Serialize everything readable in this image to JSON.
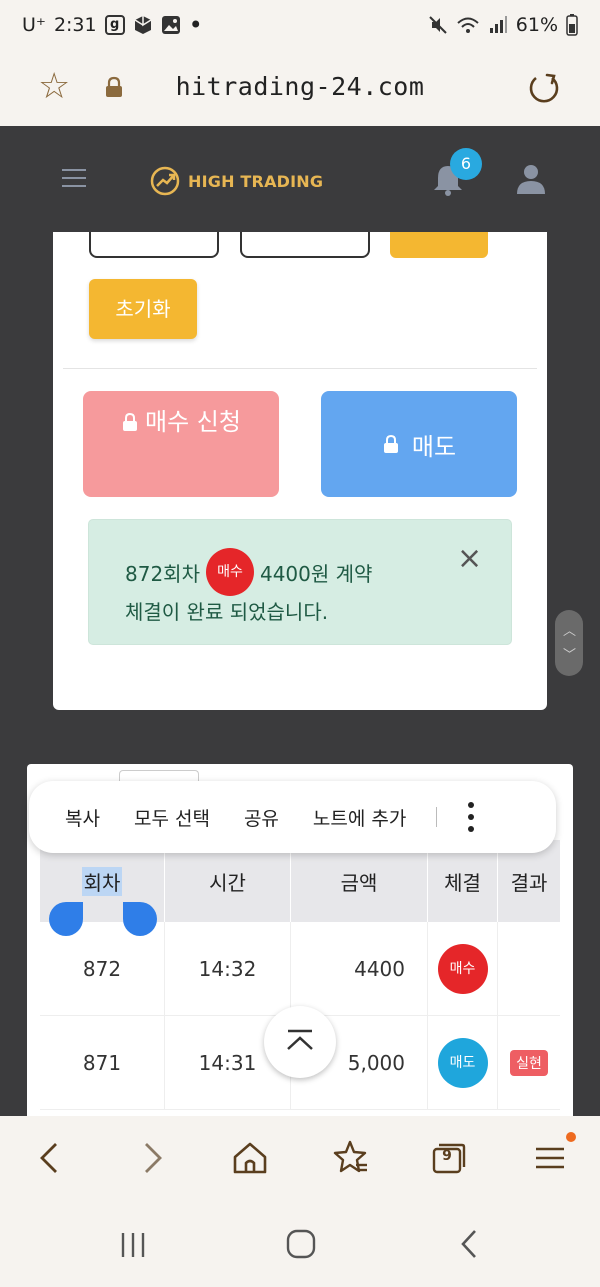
{
  "status_bar": {
    "carrier": "U⁺",
    "time": "2:31",
    "app_icon_g": "g",
    "battery": "61%",
    "icons": [
      "box-icon",
      "image-icon",
      "mute-icon",
      "wifi-icon",
      "signal-icon",
      "battery-icon"
    ]
  },
  "browser": {
    "url": "hitrading-24.com",
    "icons": [
      "star-icon",
      "lock-icon",
      "reload-icon"
    ]
  },
  "site_header": {
    "logo_text": "HIGH TRADING",
    "notification_count": "6",
    "icons": [
      "hamburger-icon",
      "logo-mark-icon",
      "bell-icon",
      "user-icon"
    ]
  },
  "trade_panel": {
    "reset_label": "초기화",
    "buy_label": "매수 신청",
    "sell_label": "매도",
    "alert": {
      "line1_prefix": "872회차",
      "badge": "매수",
      "line1_suffix": "4400원 계약",
      "line2": "체결이 완료 되었습니다.",
      "close": "×"
    }
  },
  "context_menu": {
    "items": [
      "복사",
      "모두 선택",
      "공유",
      "노트에 추가"
    ]
  },
  "history_table": {
    "headers": [
      "회차",
      "시간",
      "금액",
      "체결",
      "결과"
    ],
    "rows": [
      {
        "round": "872",
        "time": "14:32",
        "amount": "4400",
        "type": "매수",
        "type_color": "#e52629",
        "result": ""
      },
      {
        "round": "871",
        "time": "14:31",
        "amount": "5,000",
        "type": "매도",
        "type_color": "#1fa6dc",
        "result": "실현"
      }
    ]
  },
  "bottom_toolbar": {
    "tab_count": "9",
    "icons": [
      "back-icon",
      "forward-icon",
      "home-icon",
      "bookmarks-icon",
      "tabs-icon",
      "menu-icon"
    ]
  },
  "colors": {
    "accent_gold": "#f4b731",
    "buy": "#f69a9c",
    "sell": "#63a6f0",
    "alert_bg": "#d6ede3",
    "site_bg": "#3b3b3d"
  }
}
